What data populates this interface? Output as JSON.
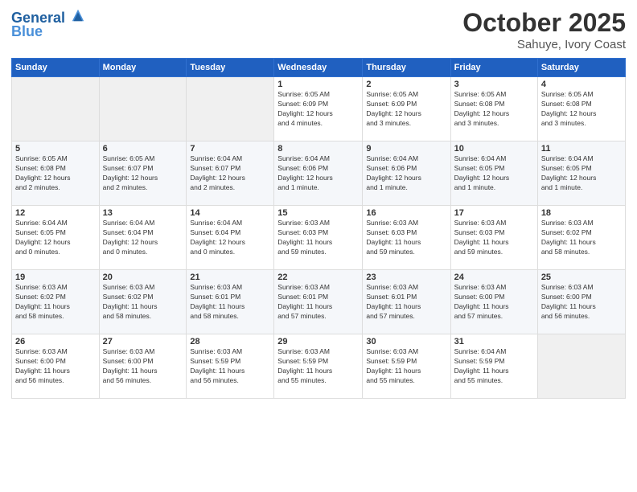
{
  "header": {
    "logo_line1": "General",
    "logo_line2": "Blue",
    "month": "October 2025",
    "location": "Sahuye, Ivory Coast"
  },
  "weekdays": [
    "Sunday",
    "Monday",
    "Tuesday",
    "Wednesday",
    "Thursday",
    "Friday",
    "Saturday"
  ],
  "weeks": [
    [
      {
        "day": "",
        "info": ""
      },
      {
        "day": "",
        "info": ""
      },
      {
        "day": "",
        "info": ""
      },
      {
        "day": "1",
        "info": "Sunrise: 6:05 AM\nSunset: 6:09 PM\nDaylight: 12 hours\nand 4 minutes."
      },
      {
        "day": "2",
        "info": "Sunrise: 6:05 AM\nSunset: 6:09 PM\nDaylight: 12 hours\nand 3 minutes."
      },
      {
        "day": "3",
        "info": "Sunrise: 6:05 AM\nSunset: 6:08 PM\nDaylight: 12 hours\nand 3 minutes."
      },
      {
        "day": "4",
        "info": "Sunrise: 6:05 AM\nSunset: 6:08 PM\nDaylight: 12 hours\nand 3 minutes."
      }
    ],
    [
      {
        "day": "5",
        "info": "Sunrise: 6:05 AM\nSunset: 6:08 PM\nDaylight: 12 hours\nand 2 minutes."
      },
      {
        "day": "6",
        "info": "Sunrise: 6:05 AM\nSunset: 6:07 PM\nDaylight: 12 hours\nand 2 minutes."
      },
      {
        "day": "7",
        "info": "Sunrise: 6:04 AM\nSunset: 6:07 PM\nDaylight: 12 hours\nand 2 minutes."
      },
      {
        "day": "8",
        "info": "Sunrise: 6:04 AM\nSunset: 6:06 PM\nDaylight: 12 hours\nand 1 minute."
      },
      {
        "day": "9",
        "info": "Sunrise: 6:04 AM\nSunset: 6:06 PM\nDaylight: 12 hours\nand 1 minute."
      },
      {
        "day": "10",
        "info": "Sunrise: 6:04 AM\nSunset: 6:05 PM\nDaylight: 12 hours\nand 1 minute."
      },
      {
        "day": "11",
        "info": "Sunrise: 6:04 AM\nSunset: 6:05 PM\nDaylight: 12 hours\nand 1 minute."
      }
    ],
    [
      {
        "day": "12",
        "info": "Sunrise: 6:04 AM\nSunset: 6:05 PM\nDaylight: 12 hours\nand 0 minutes."
      },
      {
        "day": "13",
        "info": "Sunrise: 6:04 AM\nSunset: 6:04 PM\nDaylight: 12 hours\nand 0 minutes."
      },
      {
        "day": "14",
        "info": "Sunrise: 6:04 AM\nSunset: 6:04 PM\nDaylight: 12 hours\nand 0 minutes."
      },
      {
        "day": "15",
        "info": "Sunrise: 6:03 AM\nSunset: 6:03 PM\nDaylight: 11 hours\nand 59 minutes."
      },
      {
        "day": "16",
        "info": "Sunrise: 6:03 AM\nSunset: 6:03 PM\nDaylight: 11 hours\nand 59 minutes."
      },
      {
        "day": "17",
        "info": "Sunrise: 6:03 AM\nSunset: 6:03 PM\nDaylight: 11 hours\nand 59 minutes."
      },
      {
        "day": "18",
        "info": "Sunrise: 6:03 AM\nSunset: 6:02 PM\nDaylight: 11 hours\nand 58 minutes."
      }
    ],
    [
      {
        "day": "19",
        "info": "Sunrise: 6:03 AM\nSunset: 6:02 PM\nDaylight: 11 hours\nand 58 minutes."
      },
      {
        "day": "20",
        "info": "Sunrise: 6:03 AM\nSunset: 6:02 PM\nDaylight: 11 hours\nand 58 minutes."
      },
      {
        "day": "21",
        "info": "Sunrise: 6:03 AM\nSunset: 6:01 PM\nDaylight: 11 hours\nand 58 minutes."
      },
      {
        "day": "22",
        "info": "Sunrise: 6:03 AM\nSunset: 6:01 PM\nDaylight: 11 hours\nand 57 minutes."
      },
      {
        "day": "23",
        "info": "Sunrise: 6:03 AM\nSunset: 6:01 PM\nDaylight: 11 hours\nand 57 minutes."
      },
      {
        "day": "24",
        "info": "Sunrise: 6:03 AM\nSunset: 6:00 PM\nDaylight: 11 hours\nand 57 minutes."
      },
      {
        "day": "25",
        "info": "Sunrise: 6:03 AM\nSunset: 6:00 PM\nDaylight: 11 hours\nand 56 minutes."
      }
    ],
    [
      {
        "day": "26",
        "info": "Sunrise: 6:03 AM\nSunset: 6:00 PM\nDaylight: 11 hours\nand 56 minutes."
      },
      {
        "day": "27",
        "info": "Sunrise: 6:03 AM\nSunset: 6:00 PM\nDaylight: 11 hours\nand 56 minutes."
      },
      {
        "day": "28",
        "info": "Sunrise: 6:03 AM\nSunset: 5:59 PM\nDaylight: 11 hours\nand 56 minutes."
      },
      {
        "day": "29",
        "info": "Sunrise: 6:03 AM\nSunset: 5:59 PM\nDaylight: 11 hours\nand 55 minutes."
      },
      {
        "day": "30",
        "info": "Sunrise: 6:03 AM\nSunset: 5:59 PM\nDaylight: 11 hours\nand 55 minutes."
      },
      {
        "day": "31",
        "info": "Sunrise: 6:04 AM\nSunset: 5:59 PM\nDaylight: 11 hours\nand 55 minutes."
      },
      {
        "day": "",
        "info": ""
      }
    ]
  ]
}
